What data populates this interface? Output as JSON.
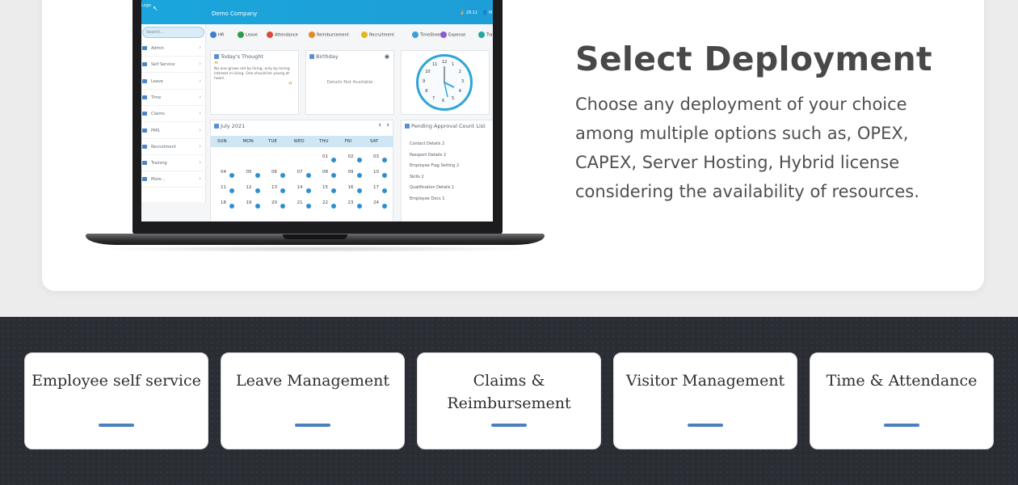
{
  "section": {
    "heading": "Select Deployment",
    "description": "Choose any deployment of your choice among multiple options such as, OPEX, CAPEX, Server Hosting, Hybrid license considering the availability of resources."
  },
  "app": {
    "company": "Demo Company",
    "logo_text": "Logo",
    "header_time": "29.11",
    "header_user": "M",
    "search_placeholder": "Search...",
    "sidebar": [
      "Admin",
      "Self Service",
      "Leave",
      "Time",
      "Claims",
      "PMS",
      "Recruitment",
      "Training",
      "More..."
    ],
    "modules": [
      {
        "label": "HR",
        "color": "#3b7fd0"
      },
      {
        "label": "Leave",
        "color": "#2e9a52"
      },
      {
        "label": "Attendance",
        "color": "#d84a3a"
      },
      {
        "label": "Reimbursement",
        "color": "#e08a2a"
      },
      {
        "label": "Recruitment",
        "color": "#e2b424"
      },
      {
        "label": "TimeSheet",
        "color": "#3aa0d8"
      },
      {
        "label": "Expense",
        "color": "#8a5ad0"
      },
      {
        "label": "Travel",
        "color": "#23a6a0"
      }
    ],
    "thought": {
      "title": "Today's Thought",
      "text": "No one grows old by living, only by losing interest in living. One should be young at heart."
    },
    "birthday": {
      "title": "Birthday",
      "empty": "Details Not Available"
    },
    "clock_numbers": [
      "12",
      "1",
      "2",
      "3",
      "4",
      "5",
      "6",
      "7",
      "8",
      "9",
      "10",
      "11"
    ],
    "calendar": {
      "title": "July 2021",
      "days": [
        "SUN",
        "MON",
        "TUE",
        "WED",
        "THU",
        "FRI",
        "SAT"
      ],
      "rows": [
        [
          "",
          "",
          "",
          "",
          "01",
          "02",
          "03"
        ],
        [
          "04",
          "05",
          "06",
          "07",
          "08",
          "09",
          "10"
        ],
        [
          "11",
          "12",
          "13",
          "14",
          "15",
          "16",
          "17"
        ],
        [
          "18",
          "19",
          "20",
          "21",
          "22",
          "23",
          "24"
        ]
      ]
    },
    "pending": {
      "title": "Pending Approval Count List",
      "items": [
        {
          "label": "Contact Details",
          "count": "2"
        },
        {
          "label": "Passport Details",
          "count": "2"
        },
        {
          "label": "Employee Flag Setting",
          "count": "2"
        },
        {
          "label": "Skills",
          "count": "2"
        },
        {
          "label": "Qualification Details",
          "count": "1"
        },
        {
          "label": "Employee Docs",
          "count": "1"
        }
      ]
    }
  },
  "features": [
    {
      "title": "Employee self service"
    },
    {
      "title": "Leave Management"
    },
    {
      "title": "Claims & Reimbursement"
    },
    {
      "title": "Visitor Management"
    },
    {
      "title": "Time & Attendance"
    }
  ],
  "colors": {
    "accent": "#4a7fc1",
    "app_header": "#1aa6dc",
    "dark_band": "#2a2e34"
  }
}
